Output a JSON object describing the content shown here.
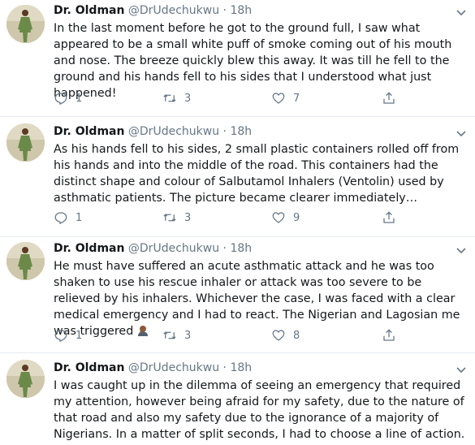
{
  "colors": {
    "text": "#14171a",
    "muted": "#657786",
    "divider": "#e6ecf0"
  },
  "tweets": [
    {
      "name": "Dr. Oldman",
      "handle": "@DrUdechukwu",
      "dot": "·",
      "time": "18h",
      "text": "In the last moment before he got to the ground full, I saw what appeared to be a small white puff of smoke coming out of his mouth and nose. The breeze quickly blew this away. It was till he fell to the ground and his hands fell to his sides that I understood what just happened!",
      "replies": "1",
      "retweets": "3",
      "likes": "7"
    },
    {
      "name": "Dr. Oldman",
      "handle": "@DrUdechukwu",
      "dot": "·",
      "time": "18h",
      "text": "As his hands fell to his sides, 2 small plastic containers rolled off from his hands and into the middle of the road. This containers had the distinct shape and colour of Salbutamol Inhalers (Ventolin) used by asthmatic patients. The picture became clearer immediately…",
      "replies": "1",
      "retweets": "3",
      "likes": "9"
    },
    {
      "name": "Dr. Oldman",
      "handle": "@DrUdechukwu",
      "dot": "·",
      "time": "18h",
      "text": "He must have suffered an acute asthmatic attack and he was too shaken to use his rescue inhaler or attack was too severe to be relieved by his inhalers. Whichever the case, I was faced with a clear medical emergency and I had to react. The Nigerian and Lagosian me was triggered",
      "emoji": "person-facepalming-emoji",
      "replies": "1",
      "retweets": "3",
      "likes": "8"
    },
    {
      "name": "Dr. Oldman",
      "handle": "@DrUdechukwu",
      "dot": "·",
      "time": "18h",
      "text": "I was caught up in the dilemma of seeing an emergency that required my attention, however being afraid for my safety, due to the nature of that road and also my safety due to the ignorance of a majority of Nigerians. In a matter of split seconds, I had to choose a line of action."
    }
  ]
}
